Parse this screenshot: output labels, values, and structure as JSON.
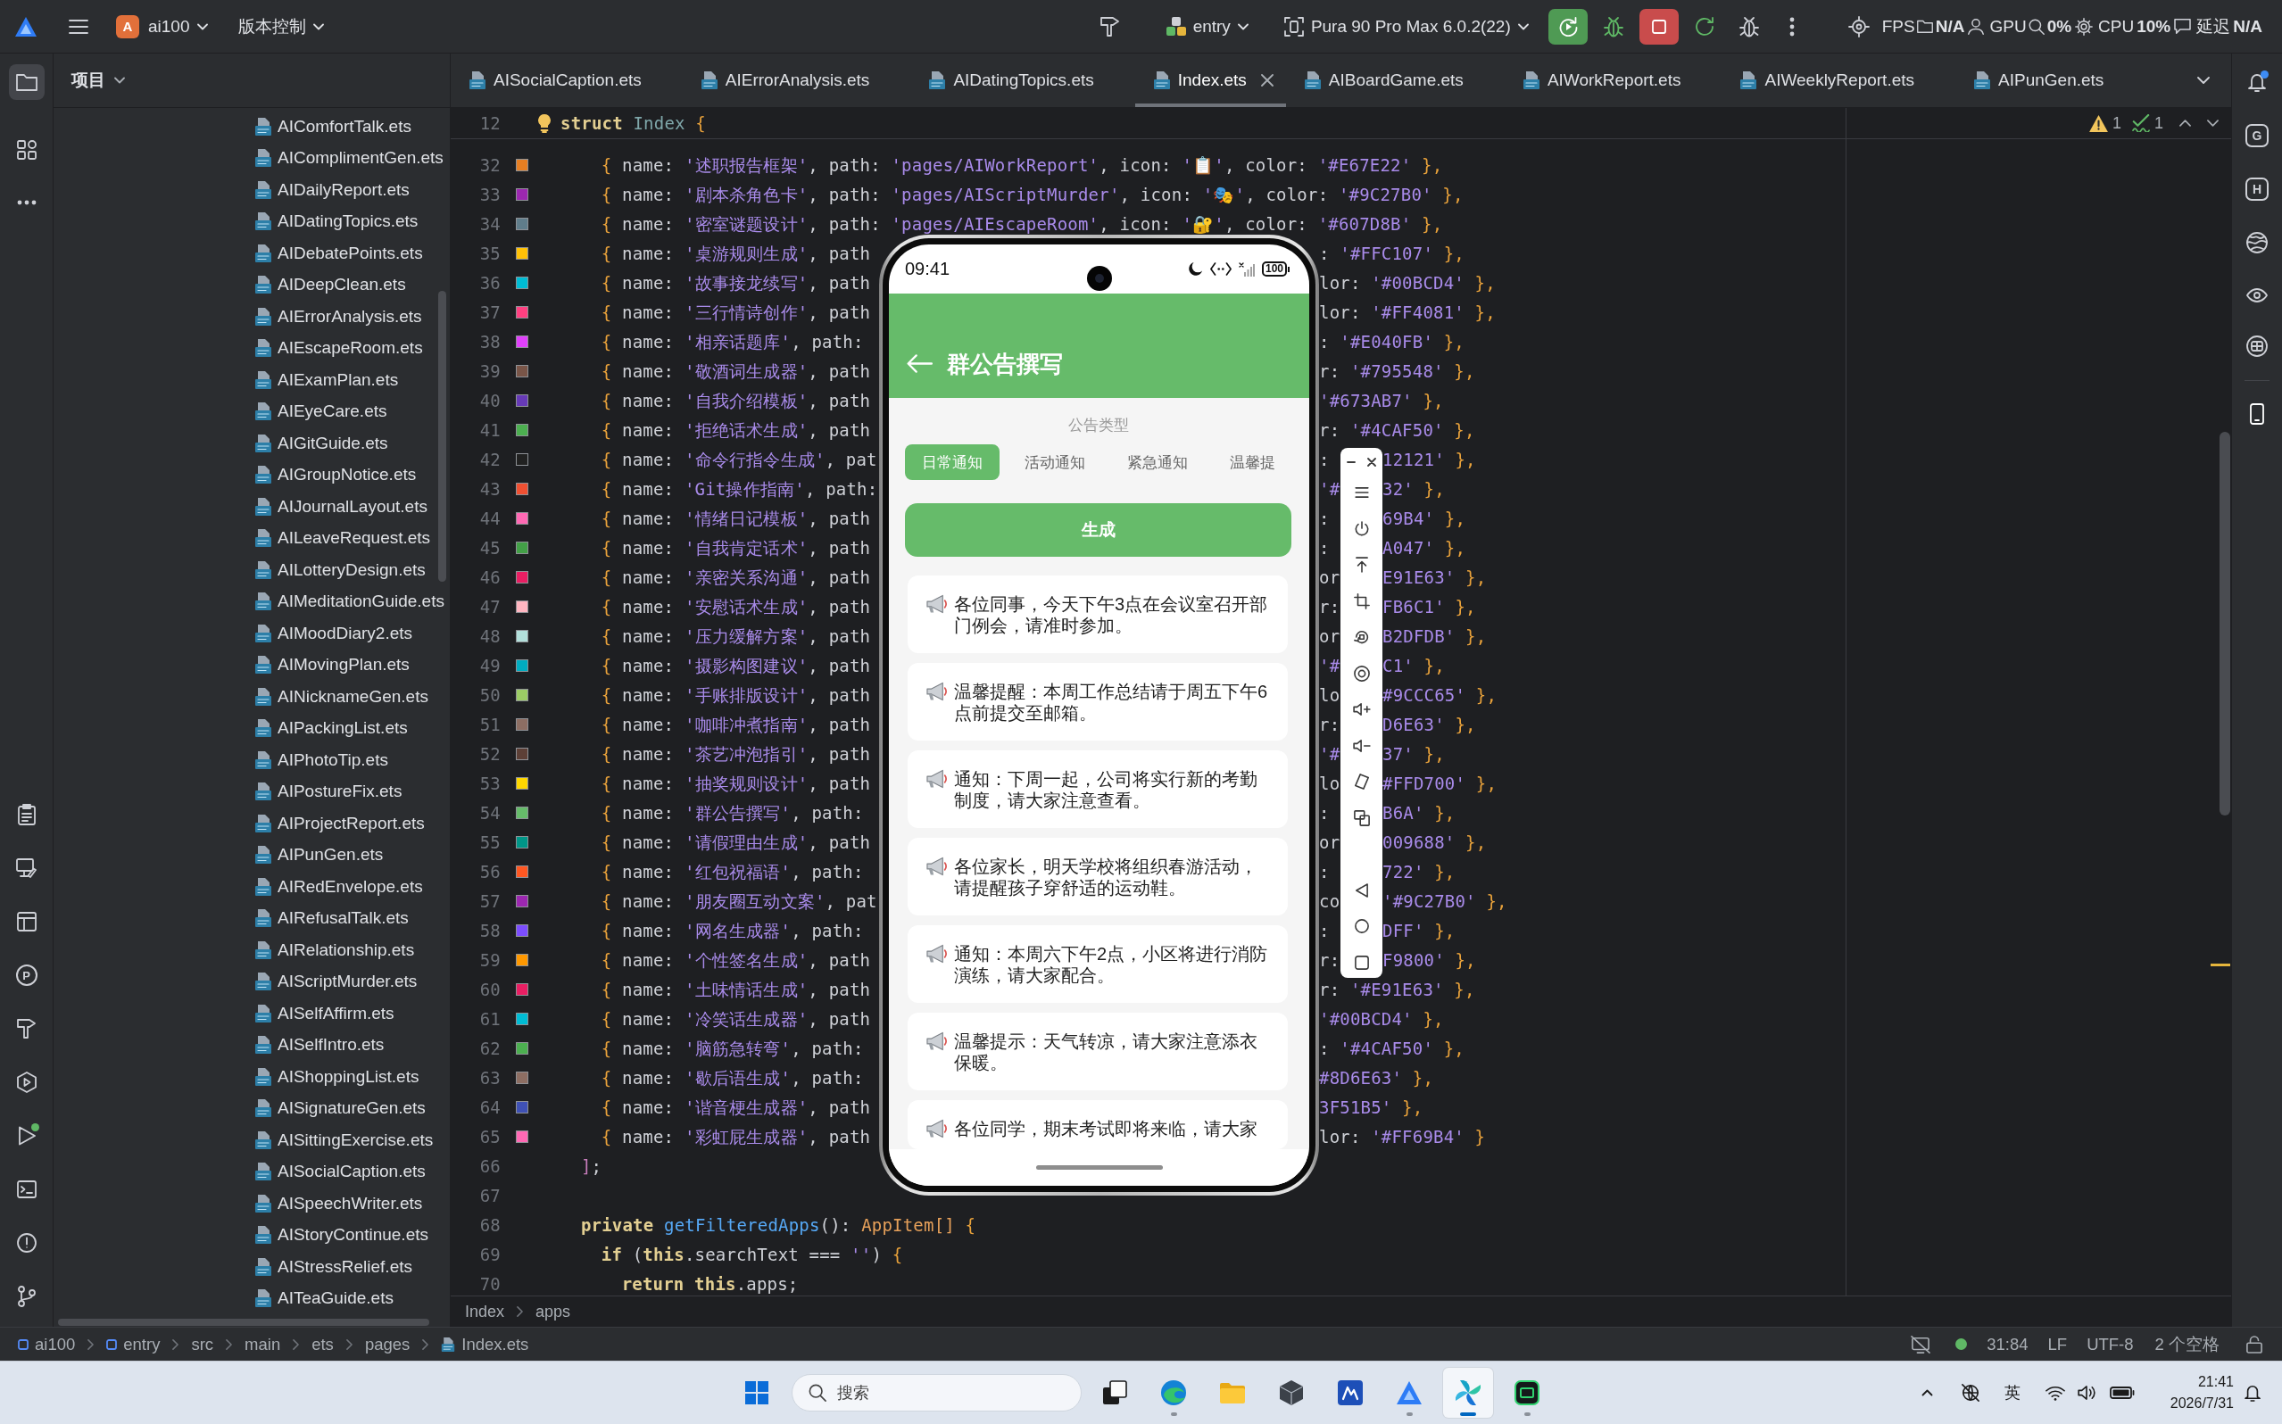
{
  "toolbar": {
    "project_badge": "A",
    "project": "ai100",
    "vcs": "版本控制",
    "module": "entry",
    "device": "Pura 90 Pro Max 6.0.2(22)",
    "stats": [
      {
        "label": "FPS",
        "value": "N/A"
      },
      {
        "label": "GPU",
        "value": "0%"
      },
      {
        "label": "CPU",
        "value": "10%"
      },
      {
        "label": "延迟",
        "value": "N/A"
      }
    ]
  },
  "activity_bar": {
    "views": [
      {
        "selected": true
      },
      {
        "selected": false
      }
    ],
    "profiler_letter": "P",
    "app_running": true
  },
  "project_panel": {
    "title": "项目",
    "files": [
      "AIComfortTalk.ets",
      "AIComplimentGen.ets",
      "AIDailyReport.ets",
      "AIDatingTopics.ets",
      "AIDebatePoints.ets",
      "AIDeepClean.ets",
      "AIErrorAnalysis.ets",
      "AIEscapeRoom.ets",
      "AIExamPlan.ets",
      "AIEyeCare.ets",
      "AIGitGuide.ets",
      "AIGroupNotice.ets",
      "AIJournalLayout.ets",
      "AILeaveRequest.ets",
      "AILotteryDesign.ets",
      "AIMeditationGuide.ets",
      "AIMoodDiary2.ets",
      "AIMovingPlan.ets",
      "AINicknameGen.ets",
      "AIPackingList.ets",
      "AIPhotoTip.ets",
      "AIPostureFix.ets",
      "AIProjectReport.ets",
      "AIPunGen.ets",
      "AIRedEnvelope.ets",
      "AIRefusalTalk.ets",
      "AIRelationship.ets",
      "AIScriptMurder.ets",
      "AISelfAffirm.ets",
      "AISelfIntro.ets",
      "AIShoppingList.ets",
      "AISignatureGen.ets",
      "AISittingExercise.ets",
      "AISocialCaption.ets",
      "AISpeechWriter.ets",
      "AIStoryContinue.ets",
      "AIStressRelief.ets",
      "AITeaGuide.ets"
    ]
  },
  "editor": {
    "tabs": [
      {
        "label": "AISocialCaption.ets",
        "selected": false
      },
      {
        "label": "AIErrorAnalysis.ets",
        "selected": false
      },
      {
        "label": "AIDatingTopics.ets",
        "selected": false
      },
      {
        "label": "Index.ets",
        "selected": true
      },
      {
        "label": "AIBoardGame.ets",
        "selected": false
      },
      {
        "label": "AIWorkReport.ets",
        "selected": false
      },
      {
        "label": "AIWeeklyReport.ets",
        "selected": false
      },
      {
        "label": "AIPunGen.ets",
        "selected": false
      }
    ],
    "sticky_line": {
      "number": "12",
      "tokens": [
        {
          "kind": "keyword",
          "text": "struct"
        },
        {
          "kind": "type",
          "text": " Index"
        },
        {
          "kind": "brace",
          "text": " {"
        }
      ]
    },
    "inspections": {
      "warnings": "1",
      "passed": "1"
    },
    "lines": [
      {
        "number": "32",
        "color": "#E67E22",
        "parts": [
          [
            {
              "kind": "brace",
              "text": "    {"
            },
            {
              "kind": "plain",
              "text": " name: "
            },
            {
              "kind": "str",
              "text": "'述职报告框架'"
            },
            {
              "kind": "plain",
              "text": ", path: "
            },
            {
              "kind": "str",
              "text": "'pages/AIWorkReport'"
            },
            {
              "kind": "plain",
              "text": ", icon: "
            },
            {
              "kind": "str",
              "text": "'📋'"
            },
            {
              "kind": "plain",
              "text": ", color: "
            },
            {
              "kind": "str",
              "text": "'#E67E22'"
            },
            {
              "kind": "brace",
              "text": " },"
            }
          ]
        ]
      },
      {
        "number": "33",
        "color": "#9C27B0",
        "parts": [
          [
            {
              "kind": "brace",
              "text": "    {"
            },
            {
              "kind": "plain",
              "text": " name: "
            },
            {
              "kind": "str",
              "text": "'剧本杀角色卡'"
            },
            {
              "kind": "plain",
              "text": ", path: "
            },
            {
              "kind": "str",
              "text": "'pages/AIScriptMurder'"
            },
            {
              "kind": "plain",
              "text": ", icon: "
            },
            {
              "kind": "str",
              "text": "'🎭'"
            },
            {
              "kind": "plain",
              "text": ", color: "
            },
            {
              "kind": "str",
              "text": "'#9C27B0'"
            },
            {
              "kind": "brace",
              "text": " },"
            }
          ]
        ]
      },
      {
        "number": "34",
        "color": "#607D8B",
        "parts": [
          [
            {
              "kind": "brace",
              "text": "    {"
            },
            {
              "kind": "plain",
              "text": " name: "
            },
            {
              "kind": "str",
              "text": "'密室谜题设计'"
            },
            {
              "kind": "plain",
              "text": ", path: "
            },
            {
              "kind": "str",
              "text": "'pages/AIEscapeRoom'"
            },
            {
              "kind": "plain",
              "text": ", icon: "
            },
            {
              "kind": "str",
              "text": "'🔐'"
            },
            {
              "kind": "plain",
              "text": ", color: "
            },
            {
              "kind": "str",
              "text": "'#607D8B'"
            },
            {
              "kind": "brace",
              "text": " },"
            }
          ]
        ]
      },
      {
        "number": "35",
        "color": "#FFC107",
        "parts": [
          [
            {
              "kind": "brace",
              "text": "    {"
            },
            {
              "kind": "plain",
              "text": " name: "
            },
            {
              "kind": "str",
              "text": "'桌游规则生成'"
            },
            {
              "kind": "plain",
              "text": ", path"
            }
          ],
          [
            {
              "kind": "plain",
              "text": ": "
            },
            {
              "kind": "str",
              "text": "'#FFC107'"
            },
            {
              "kind": "brace",
              "text": " },"
            }
          ]
        ]
      },
      {
        "number": "36",
        "color": "#00BCD4",
        "parts": [
          [
            {
              "kind": "brace",
              "text": "    {"
            },
            {
              "kind": "plain",
              "text": " name: "
            },
            {
              "kind": "str",
              "text": "'故事接龙续写'"
            },
            {
              "kind": "plain",
              "text": ", path"
            }
          ],
          [
            {
              "kind": "plain",
              "text": "lor: "
            },
            {
              "kind": "str",
              "text": "'#00BCD4'"
            },
            {
              "kind": "brace",
              "text": " },"
            }
          ]
        ]
      },
      {
        "number": "37",
        "color": "#FF4081",
        "parts": [
          [
            {
              "kind": "brace",
              "text": "    {"
            },
            {
              "kind": "plain",
              "text": " name: "
            },
            {
              "kind": "str",
              "text": "'三行情诗创作'"
            },
            {
              "kind": "plain",
              "text": ", path"
            }
          ],
          [
            {
              "kind": "plain",
              "text": "lor: "
            },
            {
              "kind": "str",
              "text": "'#FF4081'"
            },
            {
              "kind": "brace",
              "text": " },"
            }
          ]
        ]
      },
      {
        "number": "38",
        "color": "#E040FB",
        "parts": [
          [
            {
              "kind": "brace",
              "text": "    {"
            },
            {
              "kind": "plain",
              "text": " name: "
            },
            {
              "kind": "str",
              "text": "'相亲话题库'"
            },
            {
              "kind": "plain",
              "text": ", path:"
            }
          ],
          [
            {
              "kind": "plain",
              "text": ": "
            },
            {
              "kind": "str",
              "text": "'#E040FB'"
            },
            {
              "kind": "brace",
              "text": " },"
            }
          ]
        ]
      },
      {
        "number": "39",
        "color": "#795548",
        "parts": [
          [
            {
              "kind": "brace",
              "text": "    {"
            },
            {
              "kind": "plain",
              "text": " name: "
            },
            {
              "kind": "str",
              "text": "'敬酒词生成器'"
            },
            {
              "kind": "plain",
              "text": ", path"
            }
          ],
          [
            {
              "kind": "plain",
              "text": "r: "
            },
            {
              "kind": "str",
              "text": "'#795548'"
            },
            {
              "kind": "brace",
              "text": " },"
            }
          ]
        ]
      },
      {
        "number": "40",
        "color": "#673AB7",
        "parts": [
          [
            {
              "kind": "brace",
              "text": "    {"
            },
            {
              "kind": "plain",
              "text": " name: "
            },
            {
              "kind": "str",
              "text": "'自我介绍模板'"
            },
            {
              "kind": "plain",
              "text": ", path"
            }
          ],
          [
            {
              "kind": "str",
              "text": "'#673AB7'"
            },
            {
              "kind": "brace",
              "text": " },"
            }
          ]
        ]
      },
      {
        "number": "41",
        "color": "#4CAF50",
        "parts": [
          [
            {
              "kind": "brace",
              "text": "    {"
            },
            {
              "kind": "plain",
              "text": " name: "
            },
            {
              "kind": "str",
              "text": "'拒绝话术生成'"
            },
            {
              "kind": "plain",
              "text": ", path"
            }
          ],
          [
            {
              "kind": "plain",
              "text": "r: "
            },
            {
              "kind": "str",
              "text": "'#4CAF50'"
            },
            {
              "kind": "brace",
              "text": " },"
            }
          ]
        ]
      },
      {
        "number": "42",
        "color": "#212121",
        "parts": [
          [
            {
              "kind": "brace",
              "text": "    {"
            },
            {
              "kind": "plain",
              "text": " name: "
            },
            {
              "kind": "str",
              "text": "'命令行指令生成'"
            },
            {
              "kind": "plain",
              "text": ", pat"
            }
          ],
          [
            {
              "kind": "plain",
              "text": ":"
            }
          ],
          [
            {
              "kind": "str",
              "text": "12121'"
            },
            {
              "kind": "brace",
              "text": " },"
            }
          ]
        ]
      },
      {
        "number": "43",
        "color": "#F05032",
        "parts": [
          [
            {
              "kind": "brace",
              "text": "    {"
            },
            {
              "kind": "plain",
              "text": " name: "
            },
            {
              "kind": "str",
              "text": "'Git操作指南'"
            },
            {
              "kind": "plain",
              "text": ", path:"
            }
          ],
          [
            {
              "kind": "str",
              "text": "'#"
            }
          ],
          [
            {
              "kind": "str",
              "text": "32'"
            },
            {
              "kind": "brace",
              "text": " },"
            }
          ]
        ]
      },
      {
        "number": "44",
        "color": "#FF69B4",
        "parts": [
          [
            {
              "kind": "brace",
              "text": "    {"
            },
            {
              "kind": "plain",
              "text": " name: "
            },
            {
              "kind": "str",
              "text": "'情绪日记模板'"
            },
            {
              "kind": "plain",
              "text": ", path"
            }
          ],
          [
            {
              "kind": "plain",
              "text": ":"
            }
          ],
          [
            {
              "kind": "str",
              "text": "69B4'"
            },
            {
              "kind": "brace",
              "text": " },"
            }
          ]
        ]
      },
      {
        "number": "45",
        "color": "#43A047",
        "parts": [
          [
            {
              "kind": "brace",
              "text": "    {"
            },
            {
              "kind": "plain",
              "text": " name: "
            },
            {
              "kind": "str",
              "text": "'自我肯定话术'"
            },
            {
              "kind": "plain",
              "text": ", path"
            }
          ],
          [
            {
              "kind": "plain",
              "text": ":"
            }
          ],
          [
            {
              "kind": "str",
              "text": "A047'"
            },
            {
              "kind": "brace",
              "text": " },"
            }
          ]
        ]
      },
      {
        "number": "46",
        "color": "#E91E63",
        "parts": [
          [
            {
              "kind": "brace",
              "text": "    {"
            },
            {
              "kind": "plain",
              "text": " name: "
            },
            {
              "kind": "str",
              "text": "'亲密关系沟通'"
            },
            {
              "kind": "plain",
              "text": ", path"
            }
          ],
          [
            {
              "kind": "plain",
              "text": "or"
            }
          ],
          [
            {
              "kind": "str",
              "text": "E91E63'"
            },
            {
              "kind": "brace",
              "text": " },"
            }
          ]
        ]
      },
      {
        "number": "47",
        "color": "#FFB6C1",
        "parts": [
          [
            {
              "kind": "brace",
              "text": "    {"
            },
            {
              "kind": "plain",
              "text": " name: "
            },
            {
              "kind": "str",
              "text": "'安慰话术生成'"
            },
            {
              "kind": "plain",
              "text": ", path"
            }
          ],
          [
            {
              "kind": "plain",
              "text": "r:"
            }
          ],
          [
            {
              "kind": "str",
              "text": "FB6C1'"
            },
            {
              "kind": "brace",
              "text": " },"
            }
          ]
        ]
      },
      {
        "number": "48",
        "color": "#B2DFDB",
        "parts": [
          [
            {
              "kind": "brace",
              "text": "    {"
            },
            {
              "kind": "plain",
              "text": " name: "
            },
            {
              "kind": "str",
              "text": "'压力缓解方案'"
            },
            {
              "kind": "plain",
              "text": ", path"
            }
          ],
          [
            {
              "kind": "plain",
              "text": "or"
            }
          ],
          [
            {
              "kind": "str",
              "text": "B2DFDB'"
            },
            {
              "kind": "brace",
              "text": " },"
            }
          ]
        ]
      },
      {
        "number": "49",
        "color": "#00ACC1",
        "parts": [
          [
            {
              "kind": "brace",
              "text": "    {"
            },
            {
              "kind": "plain",
              "text": " name: "
            },
            {
              "kind": "str",
              "text": "'摄影构图建议'"
            },
            {
              "kind": "plain",
              "text": ", path"
            }
          ],
          [
            {
              "kind": "str",
              "text": "'#"
            }
          ],
          [
            {
              "kind": "str",
              "text": "C1'"
            },
            {
              "kind": "brace",
              "text": " },"
            }
          ]
        ]
      },
      {
        "number": "50",
        "color": "#9CCC65",
        "parts": [
          [
            {
              "kind": "brace",
              "text": "    {"
            },
            {
              "kind": "plain",
              "text": " name: "
            },
            {
              "kind": "str",
              "text": "'手账排版设计'"
            },
            {
              "kind": "plain",
              "text": ", path"
            }
          ],
          [
            {
              "kind": "plain",
              "text": "lo"
            }
          ],
          [
            {
              "kind": "str",
              "text": "#9CCC65'"
            },
            {
              "kind": "brace",
              "text": " },"
            }
          ]
        ]
      },
      {
        "number": "51",
        "color": "#8D6E63",
        "parts": [
          [
            {
              "kind": "brace",
              "text": "    {"
            },
            {
              "kind": "plain",
              "text": " name: "
            },
            {
              "kind": "str",
              "text": "'咖啡冲煮指南'"
            },
            {
              "kind": "plain",
              "text": ", path"
            }
          ],
          [
            {
              "kind": "plain",
              "text": "r:"
            }
          ],
          [
            {
              "kind": "str",
              "text": "D6E63'"
            },
            {
              "kind": "brace",
              "text": " },"
            }
          ]
        ]
      },
      {
        "number": "52",
        "color": "#5D4037",
        "parts": [
          [
            {
              "kind": "brace",
              "text": "    {"
            },
            {
              "kind": "plain",
              "text": " name: "
            },
            {
              "kind": "str",
              "text": "'茶艺冲泡指引'"
            },
            {
              "kind": "plain",
              "text": ", path"
            }
          ],
          [
            {
              "kind": "str",
              "text": "'#"
            }
          ],
          [
            {
              "kind": "str",
              "text": "37'"
            },
            {
              "kind": "brace",
              "text": " },"
            }
          ]
        ]
      },
      {
        "number": "53",
        "color": "#FFD700",
        "parts": [
          [
            {
              "kind": "brace",
              "text": "    {"
            },
            {
              "kind": "plain",
              "text": " name: "
            },
            {
              "kind": "str",
              "text": "'抽奖规则设计'"
            },
            {
              "kind": "plain",
              "text": ", path"
            }
          ],
          [
            {
              "kind": "plain",
              "text": "lo"
            }
          ],
          [
            {
              "kind": "str",
              "text": "#FFD700'"
            },
            {
              "kind": "brace",
              "text": " },"
            }
          ]
        ]
      },
      {
        "number": "54",
        "color": "#66BB6A",
        "parts": [
          [
            {
              "kind": "brace",
              "text": "    {"
            },
            {
              "kind": "plain",
              "text": " name: "
            },
            {
              "kind": "str",
              "text": "'群公告撰写'"
            },
            {
              "kind": "plain",
              "text": ", path:"
            }
          ],
          [
            {
              "kind": "plain",
              "text": ":"
            }
          ],
          [
            {
              "kind": "str",
              "text": "B6A'"
            },
            {
              "kind": "brace",
              "text": " },"
            }
          ]
        ]
      },
      {
        "number": "55",
        "color": "#009688",
        "parts": [
          [
            {
              "kind": "brace",
              "text": "    {"
            },
            {
              "kind": "plain",
              "text": " name: "
            },
            {
              "kind": "str",
              "text": "'请假理由生成'"
            },
            {
              "kind": "plain",
              "text": ", path"
            }
          ],
          [
            {
              "kind": "plain",
              "text": "or"
            }
          ],
          [
            {
              "kind": "str",
              "text": "009688'"
            },
            {
              "kind": "brace",
              "text": " },"
            }
          ]
        ]
      },
      {
        "number": "56",
        "color": "#FF5722",
        "parts": [
          [
            {
              "kind": "brace",
              "text": "    {"
            },
            {
              "kind": "plain",
              "text": " name: "
            },
            {
              "kind": "str",
              "text": "'红包祝福语'"
            },
            {
              "kind": "plain",
              "text": ", path:"
            }
          ],
          [
            {
              "kind": "plain",
              "text": ":"
            }
          ],
          [
            {
              "kind": "str",
              "text": "722'"
            },
            {
              "kind": "brace",
              "text": " },"
            }
          ]
        ]
      },
      {
        "number": "57",
        "color": "#9C27B0",
        "parts": [
          [
            {
              "kind": "brace",
              "text": "    {"
            },
            {
              "kind": "plain",
              "text": " name: "
            },
            {
              "kind": "str",
              "text": "'朋友圈互动文案'"
            },
            {
              "kind": "plain",
              "text": ", pat"
            }
          ],
          [
            {
              "kind": "plain",
              "text": "co"
            }
          ],
          [
            {
              "kind": "str",
              "text": "'#9C27B0'"
            },
            {
              "kind": "brace",
              "text": " },"
            }
          ]
        ]
      },
      {
        "number": "58",
        "color": "#7C4DFF",
        "parts": [
          [
            {
              "kind": "brace",
              "text": "    {"
            },
            {
              "kind": "plain",
              "text": " name: "
            },
            {
              "kind": "str",
              "text": "'网名生成器'"
            },
            {
              "kind": "plain",
              "text": ", path:"
            }
          ],
          [
            {
              "kind": "plain",
              "text": ":"
            }
          ],
          [
            {
              "kind": "str",
              "text": "DFF'"
            },
            {
              "kind": "brace",
              "text": " },"
            }
          ]
        ]
      },
      {
        "number": "59",
        "color": "#FF9800",
        "parts": [
          [
            {
              "kind": "brace",
              "text": "    {"
            },
            {
              "kind": "plain",
              "text": " name: "
            },
            {
              "kind": "str",
              "text": "'个性签名生成'"
            },
            {
              "kind": "plain",
              "text": ", path"
            }
          ],
          [
            {
              "kind": "plain",
              "text": "r:"
            }
          ],
          [
            {
              "kind": "str",
              "text": "F9800'"
            },
            {
              "kind": "brace",
              "text": " },"
            }
          ]
        ]
      },
      {
        "number": "60",
        "color": "#E91E63",
        "parts": [
          [
            {
              "kind": "brace",
              "text": "    {"
            },
            {
              "kind": "plain",
              "text": " name: "
            },
            {
              "kind": "str",
              "text": "'土味情话生成'"
            },
            {
              "kind": "plain",
              "text": ", path"
            }
          ],
          [
            {
              "kind": "plain",
              "text": "r: "
            },
            {
              "kind": "str",
              "text": "'#E91E63'"
            },
            {
              "kind": "brace",
              "text": " },"
            }
          ]
        ]
      },
      {
        "number": "61",
        "color": "#00BCD4",
        "parts": [
          [
            {
              "kind": "brace",
              "text": "    {"
            },
            {
              "kind": "plain",
              "text": " name: "
            },
            {
              "kind": "str",
              "text": "'冷笑话生成器'"
            },
            {
              "kind": "plain",
              "text": ", path"
            }
          ],
          [
            {
              "kind": "str",
              "text": "'#00BCD4'"
            },
            {
              "kind": "brace",
              "text": " },"
            }
          ]
        ]
      },
      {
        "number": "62",
        "color": "#4CAF50",
        "parts": [
          [
            {
              "kind": "brace",
              "text": "    {"
            },
            {
              "kind": "plain",
              "text": " name: "
            },
            {
              "kind": "str",
              "text": "'脑筋急转弯'"
            },
            {
              "kind": "plain",
              "text": ", path:"
            }
          ],
          [
            {
              "kind": "plain",
              "text": ": "
            },
            {
              "kind": "str",
              "text": "'#4CAF50'"
            },
            {
              "kind": "brace",
              "text": " },"
            }
          ]
        ]
      },
      {
        "number": "63",
        "color": "#8D6E63",
        "parts": [
          [
            {
              "kind": "brace",
              "text": "    {"
            },
            {
              "kind": "plain",
              "text": " name: "
            },
            {
              "kind": "str",
              "text": "'歇后语生成'"
            },
            {
              "kind": "plain",
              "text": ", path:"
            }
          ],
          [
            {
              "kind": "str",
              "text": "#8D6E63'"
            },
            {
              "kind": "brace",
              "text": " },"
            }
          ]
        ]
      },
      {
        "number": "64",
        "color": "#3F51B5",
        "parts": [
          [
            {
              "kind": "brace",
              "text": "    {"
            },
            {
              "kind": "plain",
              "text": " name: "
            },
            {
              "kind": "str",
              "text": "'谐音梗生成器'"
            },
            {
              "kind": "plain",
              "text": ", path"
            }
          ],
          [
            {
              "kind": "str",
              "text": "3F51B5'"
            },
            {
              "kind": "brace",
              "text": " },"
            }
          ]
        ]
      },
      {
        "number": "65",
        "color": "#FF69B4",
        "parts": [
          [
            {
              "kind": "brace",
              "text": "    {"
            },
            {
              "kind": "plain",
              "text": " name: "
            },
            {
              "kind": "str",
              "text": "'彩虹屁生成器'"
            },
            {
              "kind": "plain",
              "text": ", path"
            }
          ],
          [
            {
              "kind": "plain",
              "text": "lor: "
            },
            {
              "kind": "str",
              "text": "'#FF69B4'"
            },
            {
              "kind": "brace",
              "text": " }"
            }
          ]
        ]
      },
      {
        "number": "66",
        "parts": [
          [
            {
              "kind": "bracket",
              "text": "  ]"
            },
            {
              "kind": "plain",
              "text": ";"
            }
          ]
        ]
      },
      {
        "number": "67"
      },
      {
        "number": "68",
        "parts": [
          [
            {
              "kind": "keyword",
              "text": "  private"
            },
            {
              "kind": "function",
              "text": " getFilteredApps"
            },
            {
              "kind": "plain",
              "text": "(): "
            },
            {
              "kind": "class",
              "text": "AppItem[]"
            },
            {
              "kind": "brace",
              "text": " {"
            }
          ]
        ]
      },
      {
        "number": "69",
        "parts": [
          [
            {
              "kind": "keyword",
              "text": "    if"
            },
            {
              "kind": "plain",
              "text": " ("
            },
            {
              "kind": "keyword",
              "text": "this"
            },
            {
              "kind": "plain",
              "text": ".searchText === "
            },
            {
              "kind": "str",
              "text": "''"
            },
            {
              "kind": "plain",
              "text": ") "
            },
            {
              "kind": "brace",
              "text": "{"
            }
          ]
        ]
      },
      {
        "number": "70",
        "parts": [
          [
            {
              "kind": "keyword",
              "text": "      return"
            },
            {
              "kind": "keyword",
              "text": " this"
            },
            {
              "kind": "plain",
              "text": ".apps;"
            }
          ]
        ]
      }
    ],
    "breadcrumb": [
      "Index",
      "apps"
    ]
  },
  "right_strip": {
    "notification_badge": true,
    "letters": [
      "G",
      "H"
    ]
  },
  "emulator": {
    "time": "09:41",
    "battery": "100",
    "title": "群公告撰写",
    "type_label": "公告类型",
    "types": [
      {
        "label": "日常通知",
        "selected": true
      },
      {
        "label": "活动通知",
        "selected": false
      },
      {
        "label": "紧急通知",
        "selected": false
      },
      {
        "label": "温馨提",
        "selected": false
      }
    ],
    "generate_button": "生成",
    "notices": [
      "各位同事，今天下午3点在会议室召开部门例会，请准时参加。",
      "温馨提醒：本周工作总结请于周五下午6点前提交至邮箱。",
      "通知：下周一起，公司将实行新的考勤制度，请大家注意查看。",
      "各位家长，明天学校将组织春游活动，请提醒孩子穿舒适的运动鞋。",
      "通知：本周六下午2点，小区将进行消防演练，请大家配合。",
      "温馨提示：天气转凉，请大家注意添衣保暖。",
      "各位同学，期末考试即将来临，请大家"
    ]
  },
  "status_bar": {
    "path": [
      {
        "label": "ai100",
        "kind": "module"
      },
      {
        "label": "entry",
        "kind": "module"
      },
      {
        "label": "src",
        "kind": "folder"
      },
      {
        "label": "main",
        "kind": "folder"
      },
      {
        "label": "ets",
        "kind": "folder"
      },
      {
        "label": "pages",
        "kind": "folder"
      },
      {
        "label": "Index.ets",
        "kind": "file"
      }
    ],
    "caret": "31:84",
    "line_ending": "LF",
    "encoding": "UTF-8",
    "indent": "2 个空格"
  },
  "taskbar": {
    "search_placeholder": "搜索",
    "apps": [
      {
        "running": false,
        "selected": false
      },
      {
        "running": true,
        "selected": false
      },
      {
        "running": false,
        "selected": false
      },
      {
        "running": false,
        "selected": false
      },
      {
        "running": false,
        "selected": false
      },
      {
        "running": true,
        "selected": false
      },
      {
        "running": true,
        "selected": true
      },
      {
        "running": true,
        "selected": false
      }
    ],
    "input_method": "英",
    "time": "21:41",
    "date": "2026/7/31"
  }
}
